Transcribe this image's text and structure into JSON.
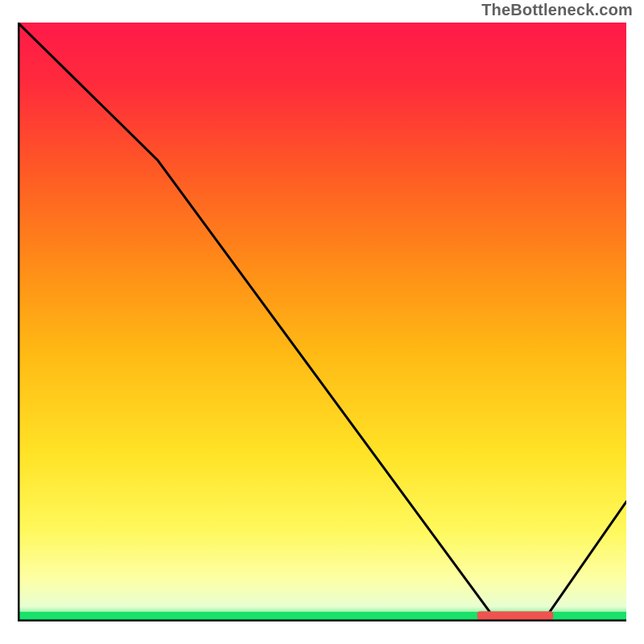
{
  "attribution": "TheBottleneck.com",
  "chart_data": {
    "type": "line",
    "title": "",
    "xlabel": "",
    "ylabel": "",
    "xlim": [
      0,
      100
    ],
    "ylim": [
      0,
      100
    ],
    "grid": false,
    "legend": false,
    "gradient_stops": [
      {
        "offset": 0.0,
        "color": "#ff1a49"
      },
      {
        "offset": 0.1,
        "color": "#ff2a3c"
      },
      {
        "offset": 0.25,
        "color": "#ff5a25"
      },
      {
        "offset": 0.4,
        "color": "#ff8a18"
      },
      {
        "offset": 0.55,
        "color": "#ffb914"
      },
      {
        "offset": 0.72,
        "color": "#ffe326"
      },
      {
        "offset": 0.85,
        "color": "#fff95e"
      },
      {
        "offset": 0.93,
        "color": "#fdffa6"
      },
      {
        "offset": 0.975,
        "color": "#e8ffd1"
      },
      {
        "offset": 1.0,
        "color": "#19e26b"
      }
    ],
    "series": [
      {
        "name": "bottleneck-curve",
        "color": "#000000",
        "x": [
          0,
          23,
          78,
          87,
          100
        ],
        "y": [
          100,
          77,
          1,
          1,
          20
        ]
      }
    ],
    "markers": [
      {
        "name": "minimum-band",
        "color": "#ef5350",
        "x_start": 75.5,
        "x_end": 88,
        "y": 1,
        "thickness": 1.4
      }
    ],
    "axes": {
      "x_ticks": [],
      "y_ticks": []
    },
    "note": "Chart has no visible numeric tick labels; x/y values are estimated percentages of plot width/height."
  }
}
